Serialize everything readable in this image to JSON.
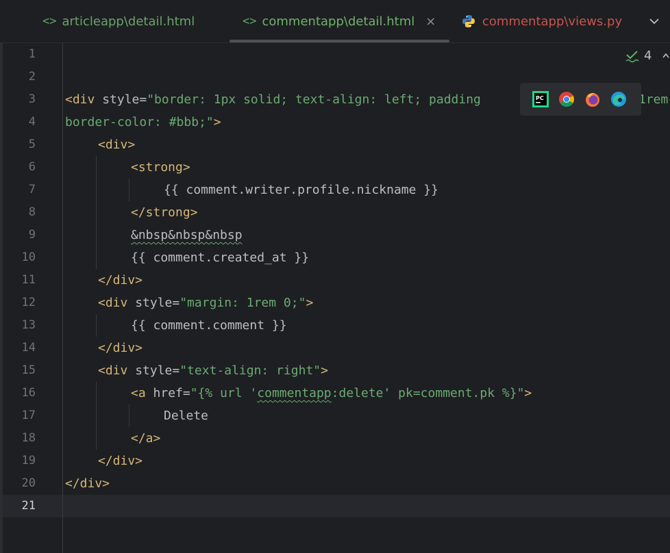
{
  "tabs": [
    {
      "label": "articleapp\\detail.html",
      "icon": "html-file-icon"
    },
    {
      "label": "commentapp\\detail.html",
      "icon": "html-file-icon",
      "active": true,
      "close_glyph": "×"
    },
    {
      "label": "commentapp\\views.py",
      "icon": "python-file-icon"
    }
  ],
  "inspection": {
    "count": "4",
    "icon": "check-mark-icon"
  },
  "browsers": [
    "pycharm-icon",
    "chrome-icon",
    "firefox-icon",
    "edge-icon"
  ],
  "line_numbers": [
    "1",
    "2",
    "3",
    "4",
    "5",
    "6",
    "7",
    "8",
    "9",
    "10",
    "11",
    "12",
    "13",
    "14",
    "15",
    "16",
    "17",
    "18",
    "19",
    "20",
    "21"
  ],
  "code": {
    "l3": {
      "tag_open": "<div",
      "attr": " style=",
      "val": "\"border: 1px solid; text-align: left; padding: 4%; margin: 1rem",
      "val_tail": " 1rem"
    },
    "l3_visible_a": "\"border: 1px solid; text-align: left; padding",
    "l3_visible_b": "1rem",
    "l4_val": "border-color: #bbb;\"",
    "l4_close": ">",
    "l5": "<div>",
    "l6": "<strong>",
    "l7": "{{ comment.writer.profile.nickname }}",
    "l8": "</strong>",
    "l9": "&nbsp&nbsp&nbsp",
    "l10": "{{ comment.created_at }}",
    "l11": "</div>",
    "l12_tag": "<div",
    "l12_attr": " style=",
    "l12_val": "\"margin: 1rem 0;\"",
    "l12_close": ">",
    "l13": "{{ comment.comment }}",
    "l14": "</div>",
    "l15_tag": "<div",
    "l15_attr": " style=",
    "l15_val": "\"text-align: right\"",
    "l15_close": ">",
    "l16_tag": "<a",
    "l16_attr": " href=",
    "l16_val_a": "\"{% url '",
    "l16_val_b": "commentapp",
    "l16_val_c": ":delete' pk=comment.pk %}\"",
    "l16_close": ">",
    "l17": "Delete",
    "l18": "</a>",
    "l19": "</div>",
    "l20": "</div>"
  },
  "colors": {
    "tag": "#d5b778",
    "string": "#6aab73",
    "text": "#bcbec4",
    "error_tab": "#c75450",
    "background": "#1e1f22"
  }
}
